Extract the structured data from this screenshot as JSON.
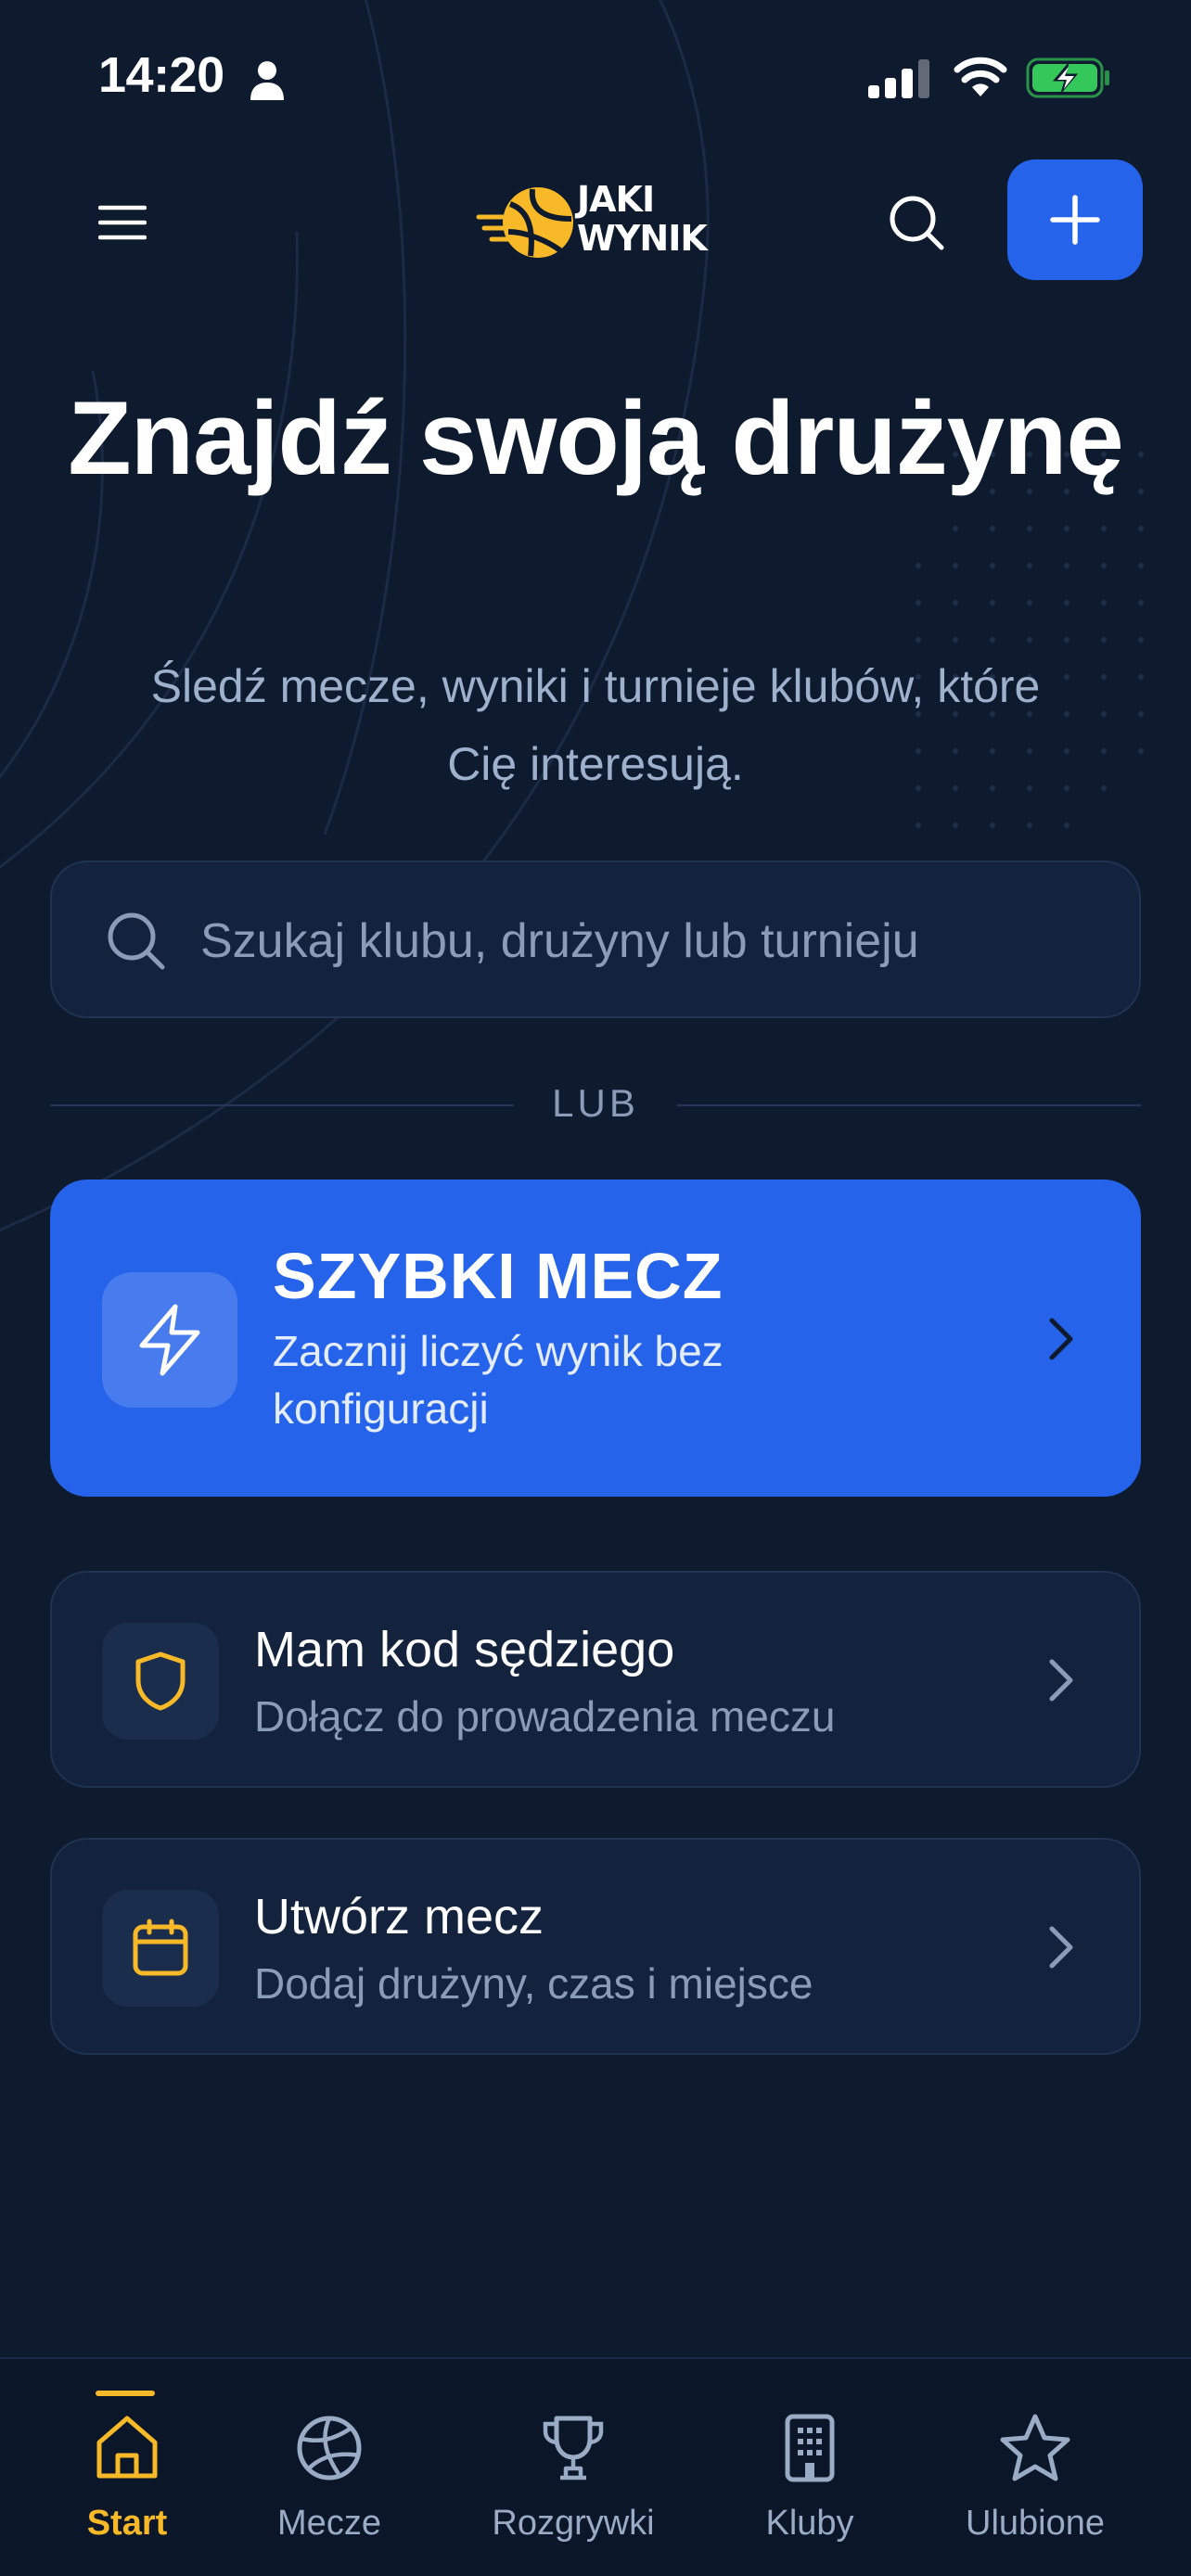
{
  "status_bar": {
    "time": "14:20",
    "icons": [
      "person-icon",
      "signal-icon",
      "wifi-icon",
      "battery-charging-icon"
    ]
  },
  "header": {
    "logo_line1": "JAKI",
    "logo_line2": "WYNIK",
    "icons": [
      "menu-icon",
      "search-icon",
      "plus-icon"
    ]
  },
  "hero": {
    "title": "Znajdź swoją drużynę",
    "subtitle": "Śledź mecze, wyniki i turnieje klubów, które Cię interesują."
  },
  "search": {
    "placeholder": "Szukaj klubu, drużyny lub turnieju",
    "value": ""
  },
  "divider": {
    "label": "LUB"
  },
  "quick_match": {
    "title": "SZYBKI MECZ",
    "description": "Zacznij liczyć wynik bez konfiguracji",
    "icon": "lightning-icon"
  },
  "actions": [
    {
      "title": "Mam kod sędziego",
      "description": "Dołącz do prowadzenia meczu",
      "icon": "shield-icon"
    },
    {
      "title": "Utwórz mecz",
      "description": "Dodaj drużyny, czas i miejsce",
      "icon": "calendar-icon"
    }
  ],
  "bottom_nav": {
    "items": [
      {
        "label": "Start",
        "icon": "home-icon",
        "active": true
      },
      {
        "label": "Mecze",
        "icon": "volleyball-icon",
        "active": false
      },
      {
        "label": "Rozgrywki",
        "icon": "trophy-icon",
        "active": false
      },
      {
        "label": "Kluby",
        "icon": "building-icon",
        "active": false
      },
      {
        "label": "Ulubione",
        "icon": "star-icon",
        "active": false
      }
    ]
  },
  "colors": {
    "background": "#0e1a2e",
    "card": "#14233d",
    "accent_blue": "#2563eb",
    "accent_yellow": "#f7b928",
    "muted_text": "#8a9cb8",
    "battery_green": "#34c759"
  }
}
